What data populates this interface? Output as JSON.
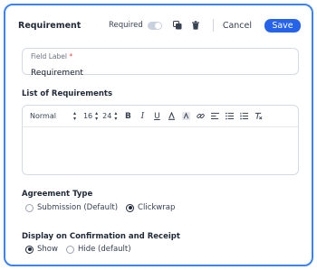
{
  "header": {
    "title": "Requirement",
    "required_label": "Required",
    "required_on": true,
    "cancel_label": "Cancel",
    "save_label": "Save"
  },
  "field": {
    "label": "Field Label",
    "required_mark": "*",
    "value": "Requirement"
  },
  "requirements": {
    "title": "List of Requirements",
    "toolbar": {
      "style": "Normal",
      "font_size": "16",
      "line_height": "24",
      "buttons": [
        "bold-icon",
        "italic-icon",
        "underline-icon",
        "text-color-icon",
        "highlight-icon",
        "link-icon",
        "align-icon",
        "bullet-list-icon",
        "numbered-list-icon",
        "clear-format-icon"
      ]
    }
  },
  "agreement": {
    "title": "Agreement Type",
    "options": [
      "Submission (Default)",
      "Clickwrap"
    ],
    "selected": "Clickwrap"
  },
  "display": {
    "title": "Display on Confirmation and Receipt",
    "options": [
      "Show",
      "Hide (default)"
    ],
    "selected": "Show"
  },
  "colors": {
    "accent": "#2563eb",
    "border_highlight": "#3b82f6"
  }
}
